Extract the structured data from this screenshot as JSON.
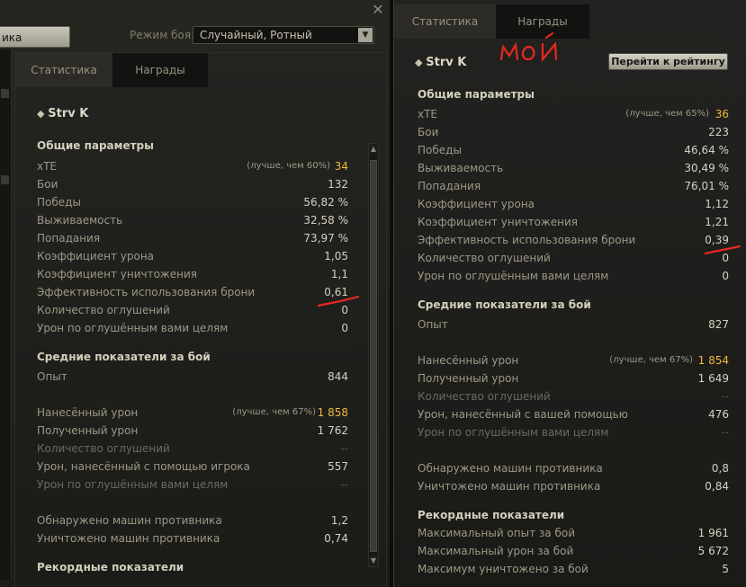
{
  "left": {
    "close_glyph": "✕",
    "partial_tab_label": "ика",
    "mode_label": "Режим боя:",
    "mode_value": "Случайный, Ротный",
    "tabs": [
      "Статистика",
      "Награды"
    ],
    "tank_icon": "◆",
    "tank_name": "Strv K",
    "sections": {
      "general": "Общие параметры",
      "average": "Средние показатели за бой",
      "records": "Рекордные показатели"
    },
    "general_rows": [
      {
        "label": "xTE",
        "note": "(лучше, чем 60%)",
        "value": "34"
      },
      {
        "label": "Бои",
        "value": "132"
      },
      {
        "label": "Победы",
        "value": "56,82 %"
      },
      {
        "label": "Выживаемость",
        "value": "32,58 %"
      },
      {
        "label": "Попадания",
        "value": "73,97 %"
      },
      {
        "label": "Коэффициент урона",
        "value": "1,05"
      },
      {
        "label": "Коэффициент уничтожения",
        "value": "1,1"
      },
      {
        "label": "Эффективность использования брони",
        "value": "0,61"
      },
      {
        "label": "Количество оглушений",
        "value": "0"
      },
      {
        "label": "Урон по оглушённым вами целям",
        "value": "0"
      }
    ],
    "average_rows": [
      {
        "label": "Опыт",
        "value": "844"
      },
      {
        "label": "Нанесённый урон",
        "note": "(лучше, чем 67%)",
        "value": "1 858"
      },
      {
        "label": "Полученный урон",
        "value": "1 762"
      },
      {
        "label": "Количество оглушений",
        "value": "--"
      },
      {
        "label": "Урон, нанесённый с помощью игрока",
        "value": "557"
      },
      {
        "label": "Урон по оглушённым вами целям",
        "value": "--"
      },
      {
        "label": "Обнаружено машин противника",
        "value": "1,2"
      },
      {
        "label": "Уничтожено машин противника",
        "value": "0,74"
      }
    ]
  },
  "right": {
    "tabs": [
      "Статистика",
      "Награды"
    ],
    "annotation": "МОЙ",
    "tank_icon": "◆",
    "tank_name": "Strv K",
    "rating_button": "Перейти к рейтингу",
    "sections": {
      "general": "Общие параметры",
      "average": "Средние показатели за бой",
      "records": "Рекордные показатели"
    },
    "general_rows": [
      {
        "label": "xTE",
        "note": "(лучше, чем 65%)",
        "value": "36"
      },
      {
        "label": "Бои",
        "value": "223"
      },
      {
        "label": "Победы",
        "value": "46,64 %"
      },
      {
        "label": "Выживаемость",
        "value": "30,49 %"
      },
      {
        "label": "Попадания",
        "value": "76,01 %"
      },
      {
        "label": "Коэффициент урона",
        "value": "1,12"
      },
      {
        "label": "Коэффициент уничтожения",
        "value": "1,21"
      },
      {
        "label": "Эффективность использования брони",
        "value": "0,39"
      },
      {
        "label": "Количество оглушений",
        "value": "0"
      },
      {
        "label": "Урон по оглушённым вами целям",
        "value": "0"
      }
    ],
    "average_rows": [
      {
        "label": "Опыт",
        "value": "827"
      },
      {
        "label": "Нанесённый урон",
        "note": "(лучше, чем 67%)",
        "value": "1 854"
      },
      {
        "label": "Полученный урон",
        "value": "1 649"
      },
      {
        "label": "Количество оглушений",
        "value": "--"
      },
      {
        "label": "Урон, нанесённый с вашей помощью",
        "value": "476"
      },
      {
        "label": "Урон по оглушённым вами целям",
        "value": "--"
      },
      {
        "label": "Обнаружено машин противника",
        "value": "0,8"
      },
      {
        "label": "Уничтожено машин противника",
        "value": "0,84"
      }
    ],
    "record_rows": [
      {
        "label": "Максимальный опыт за бой",
        "value": "1 961"
      },
      {
        "label": "Максимальный урон за бой",
        "value": "5 672"
      },
      {
        "label": "Максимум уничтожено за бой",
        "value": "5"
      }
    ]
  },
  "colors": {
    "gold": "#f0b83c",
    "annotation_red": "#e8281e"
  }
}
